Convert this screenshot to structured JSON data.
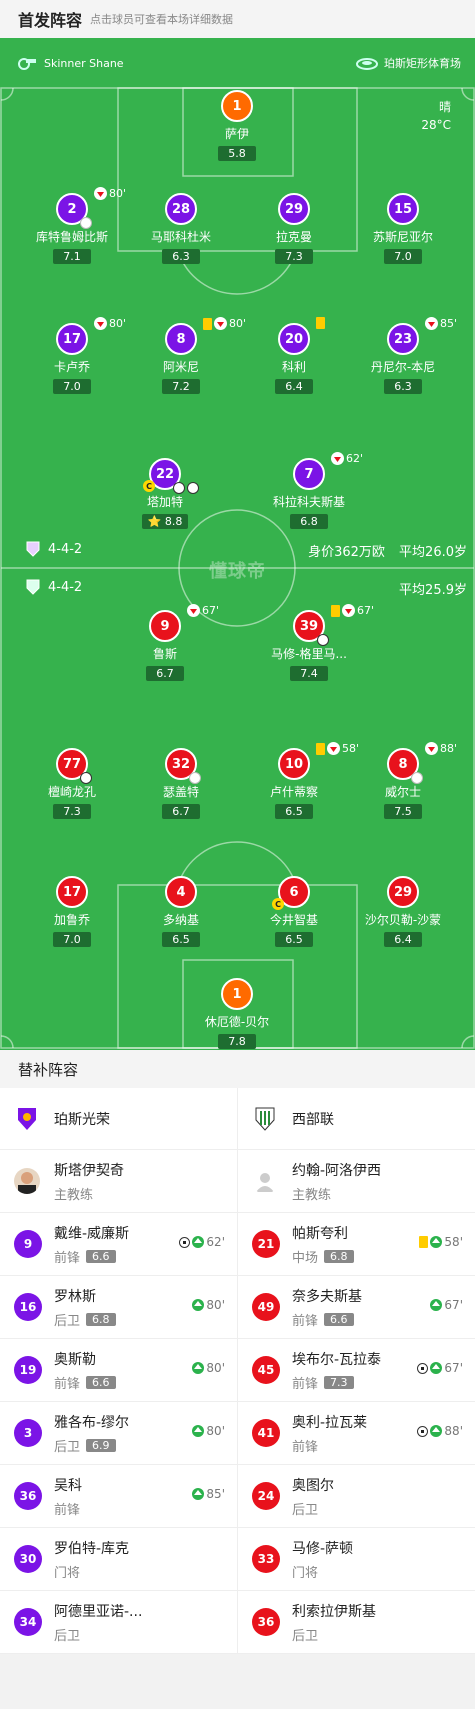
{
  "header": {
    "title": "首发阵容",
    "hint": "点击球员可查看本场详细数据"
  },
  "info": {
    "referee": "Skinner Shane",
    "stadium": "珀斯矩形体育场",
    "weather": "晴",
    "temperature": "28°C"
  },
  "home": {
    "formation": "4-4-2",
    "market_value": "身价362万欧",
    "avg_age": "平均26.0岁",
    "players": [
      {
        "num": "1",
        "name": "萨伊",
        "rating": "5.8"
      },
      {
        "num": "2",
        "name": "库特鲁姆比斯",
        "rating": "7.1",
        "sub": "80'"
      },
      {
        "num": "28",
        "name": "马耶科杜米",
        "rating": "6.3"
      },
      {
        "num": "29",
        "name": "拉克曼",
        "rating": "7.3"
      },
      {
        "num": "15",
        "name": "苏斯尼亚尔",
        "rating": "7.0"
      },
      {
        "num": "17",
        "name": "卡卢乔",
        "rating": "7.0",
        "sub": "80'"
      },
      {
        "num": "8",
        "name": "阿米尼",
        "rating": "7.2",
        "sub": "80'"
      },
      {
        "num": "20",
        "name": "科利",
        "rating": "6.4"
      },
      {
        "num": "23",
        "name": "丹尼尔-本尼",
        "rating": "6.3",
        "sub": "85'"
      },
      {
        "num": "22",
        "name": "塔加特",
        "rating": "8.8"
      },
      {
        "num": "7",
        "name": "科拉科夫斯基",
        "rating": "6.8",
        "sub": "62'"
      }
    ]
  },
  "away": {
    "formation": "4-4-2",
    "avg_age": "平均25.9岁",
    "players": [
      {
        "num": "9",
        "name": "鲁斯",
        "rating": "6.7",
        "sub": "67'"
      },
      {
        "num": "39",
        "name": "马修-格里马...",
        "rating": "7.4",
        "sub": "67'"
      },
      {
        "num": "77",
        "name": "檀崎龙孔",
        "rating": "7.3"
      },
      {
        "num": "32",
        "name": "瑟盖特",
        "rating": "6.7"
      },
      {
        "num": "10",
        "name": "卢什蒂察",
        "rating": "6.5",
        "sub": "58'"
      },
      {
        "num": "8",
        "name": "威尔士",
        "rating": "7.5",
        "sub": "88'"
      },
      {
        "num": "17",
        "name": "加鲁乔",
        "rating": "7.0"
      },
      {
        "num": "4",
        "name": "多纳基",
        "rating": "6.5"
      },
      {
        "num": "6",
        "name": "今井智基",
        "rating": "6.5"
      },
      {
        "num": "29",
        "name": "沙尔贝勒-沙蒙",
        "rating": "6.4"
      },
      {
        "num": "1",
        "name": "休厄德-贝尔",
        "rating": "7.8"
      }
    ]
  },
  "watermark": "懂球帝",
  "subs": {
    "title": "替补阵容",
    "home_team": "珀斯光荣",
    "away_team": "西部联",
    "home_coach": {
      "name": "斯塔伊契奇",
      "role": "主教练"
    },
    "away_coach": {
      "name": "约翰-阿洛伊西",
      "role": "主教练"
    },
    "home": [
      {
        "num": "9",
        "name": "戴维-威廉斯",
        "pos": "前锋",
        "rating": "6.6",
        "minute": "62'"
      },
      {
        "num": "16",
        "name": "罗林斯",
        "pos": "后卫",
        "rating": "6.8",
        "minute": "80'"
      },
      {
        "num": "19",
        "name": "奥斯勒",
        "pos": "前锋",
        "rating": "6.6",
        "minute": "80'"
      },
      {
        "num": "3",
        "name": "雅各布-缪尔",
        "pos": "后卫",
        "rating": "6.9",
        "minute": "80'"
      },
      {
        "num": "36",
        "name": "吴科",
        "pos": "前锋",
        "rating": "",
        "minute": "85'"
      },
      {
        "num": "30",
        "name": "罗伯特-库克",
        "pos": "门将",
        "rating": "",
        "minute": ""
      },
      {
        "num": "34",
        "name": "阿德里亚诺-...",
        "pos": "后卫",
        "rating": "",
        "minute": ""
      }
    ],
    "away": [
      {
        "num": "21",
        "name": "帕斯夸利",
        "pos": "中场",
        "rating": "6.8",
        "minute": "58'"
      },
      {
        "num": "49",
        "name": "奈多夫斯基",
        "pos": "前锋",
        "rating": "6.6",
        "minute": "67'"
      },
      {
        "num": "45",
        "name": "埃布尔-瓦拉泰",
        "pos": "前锋",
        "rating": "7.3",
        "minute": "67'"
      },
      {
        "num": "41",
        "name": "奥利-拉瓦莱",
        "pos": "前锋",
        "rating": "",
        "minute": "88'"
      },
      {
        "num": "24",
        "name": "奥图尔",
        "pos": "后卫",
        "rating": "",
        "minute": ""
      },
      {
        "num": "33",
        "name": "马修-萨顿",
        "pos": "门将",
        "rating": "",
        "minute": ""
      },
      {
        "num": "36",
        "name": "利索拉伊斯基",
        "pos": "后卫",
        "rating": "",
        "minute": ""
      }
    ]
  }
}
